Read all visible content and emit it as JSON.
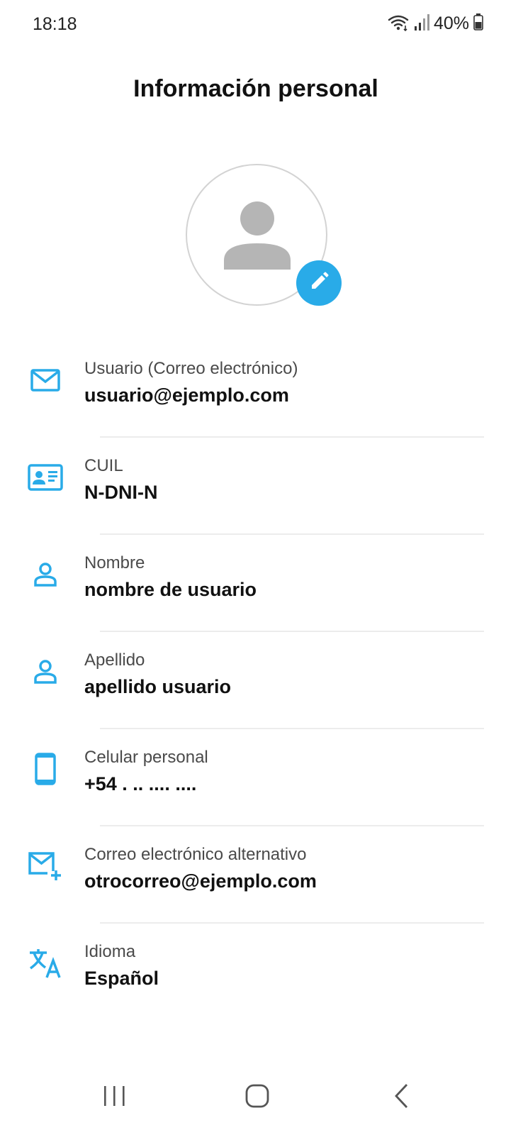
{
  "status_bar": {
    "time": "18:18",
    "battery": "40%",
    "icons": [
      "wifi-icon",
      "signal-icon",
      "battery-icon"
    ]
  },
  "header": {
    "title": "Información personal"
  },
  "avatar": {
    "icon": "person-icon",
    "edit_icon": "pencil-icon"
  },
  "fields": [
    {
      "icon": "mail-icon",
      "label": "Usuario (Correo electrónico)",
      "value": "usuario@ejemplo.com"
    },
    {
      "icon": "id-card-icon",
      "label": "CUIL",
      "value": "N-DNI-N"
    },
    {
      "icon": "person-outline-icon",
      "label": "Nombre",
      "value": "nombre de usuario"
    },
    {
      "icon": "person-outline-icon",
      "label": "Apellido",
      "value": "apellido usuario"
    },
    {
      "icon": "phone-icon",
      "label": "Celular personal",
      "value": "+54 . .. .... ...."
    },
    {
      "icon": "mail-add-icon",
      "label": "Correo electrónico alternativo",
      "value": "otrocorreo@ejemplo.com"
    },
    {
      "icon": "translate-icon",
      "label": "Idioma",
      "value": "Español"
    }
  ],
  "nav_bar": {
    "icons": [
      "recent-apps-icon",
      "home-icon",
      "back-icon"
    ]
  },
  "colors": {
    "accent": "#29abe8",
    "avatar_gray": "#b5b5b5",
    "divider": "#ececec"
  }
}
